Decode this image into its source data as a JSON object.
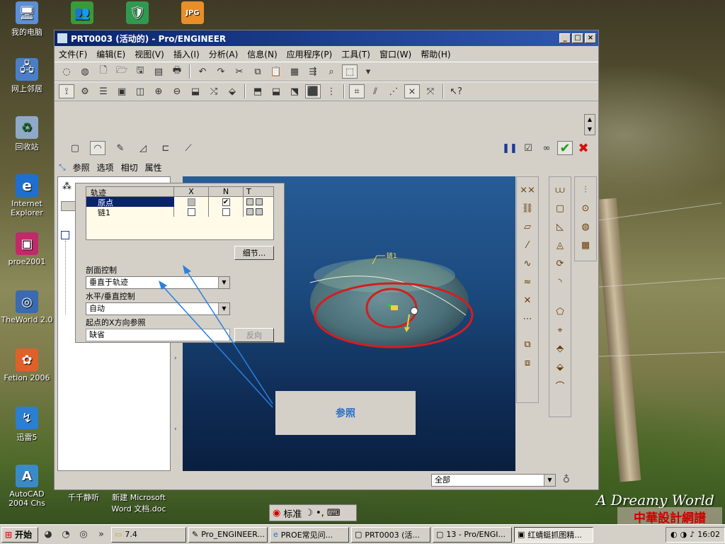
{
  "desktop": {
    "icons": [
      {
        "label": "我的电脑",
        "glyph": "🖥"
      },
      {
        "label": "",
        "glyph": "👥"
      },
      {
        "label": "",
        "glyph": "🛡"
      },
      {
        "label": "",
        "glyph": "JPG"
      },
      {
        "label": "网上邻居",
        "glyph": "🖧"
      },
      {
        "label": "回收站",
        "glyph": "♻"
      },
      {
        "label": "Internet Explorer",
        "glyph": "e"
      },
      {
        "label": "proe2001",
        "glyph": "▣"
      },
      {
        "label": "TheWorld 2.0",
        "glyph": "◎"
      },
      {
        "label": "Fetion 2006",
        "glyph": "✿"
      },
      {
        "label": "迅雷5",
        "glyph": "↯"
      },
      {
        "label": "AutoCAD 2004 Chs",
        "glyph": "A"
      },
      {
        "label": "千千静听",
        "glyph": ""
      },
      {
        "label": "新建 Microsoft Word 文档.doc",
        "glyph": ""
      }
    ],
    "brand": "A Dreamy World",
    "logo": "中華設計網譜"
  },
  "window": {
    "title": "PRT0003 (活动的) - Pro/ENGINEER",
    "controls": [
      "_",
      "□",
      "×"
    ]
  },
  "menu": [
    "文件(F)",
    "编辑(E)",
    "视图(V)",
    "插入(I)",
    "分析(A)",
    "信息(N)",
    "应用程序(P)",
    "工具(T)",
    "窗口(W)",
    "帮助(H)"
  ],
  "dashboard": {
    "tabs": [
      "参照",
      "选项",
      "相切",
      "属性"
    ]
  },
  "ref_panel": {
    "columns": [
      "轨迹",
      "X",
      "N",
      "T"
    ],
    "rows": [
      {
        "name": "原点",
        "x": "",
        "n": "✔"
      },
      {
        "name": "链1",
        "x": "",
        "n": ""
      }
    ],
    "details_button": "细节...",
    "section_control_label": "剖面控制",
    "section_control_value": "垂直于轨迹",
    "hv_control_label": "水平/垂直控制",
    "hv_control_value": "自动",
    "start_x_label": "起点的X方向参照",
    "start_x_value": "缺省",
    "flip_button": "反向"
  },
  "viewport": {
    "curve_label": "链1"
  },
  "callout": {
    "text": "参照"
  },
  "statusbar": {
    "filter": "全部"
  },
  "ime": {
    "label": "标准"
  },
  "taskbar": {
    "start": "开始",
    "tasks": [
      "7.4",
      "Pro_ENGINEER...",
      "PROE常见问...",
      "PRT0003 (活...",
      "13 - Pro/ENGI...",
      "红蜻蜓抓图精..."
    ],
    "clock": "16:02"
  },
  "colors": {
    "titlebar": "#0a246a",
    "viewport_top": "#275c96",
    "viewport_bottom": "#0a1f40",
    "sweep_curve": "#d11f1f",
    "callout_text": "#2a6fd0",
    "accept": "#1a9a1a",
    "cancel": "#d01010"
  }
}
